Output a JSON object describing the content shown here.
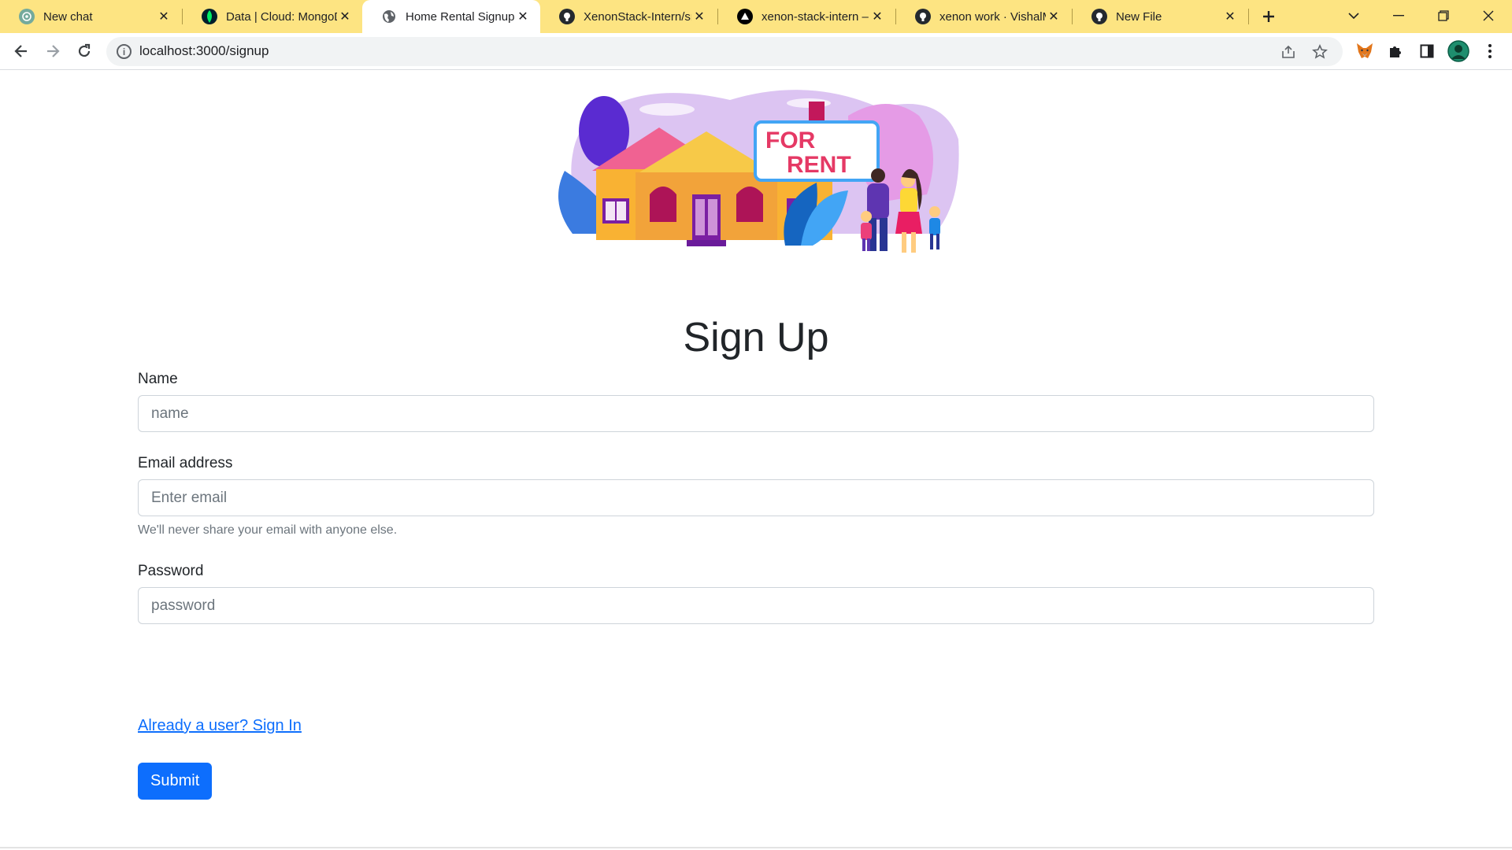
{
  "browser": {
    "tabs": [
      {
        "title": "New chat",
        "icon": "chatgpt-icon"
      },
      {
        "title": "Data | Cloud: MongoDB",
        "icon": "mongodb-leaf-icon"
      },
      {
        "title": "Home Rental Signup",
        "icon": "globe-icon"
      },
      {
        "title": "XenonStack-Intern/src",
        "icon": "github-icon"
      },
      {
        "title": "xenon-stack-intern – ",
        "icon": "vercel-icon"
      },
      {
        "title": "xenon work · VishalM",
        "icon": "github-icon"
      },
      {
        "title": "New File",
        "icon": "github-icon"
      }
    ],
    "active_tab_index": 2,
    "url": "localhost:3000/signup",
    "tab_bar_color": "#fde482"
  },
  "hero": {
    "sign_line1": "FOR",
    "sign_line2": "RENT"
  },
  "form": {
    "title": "Sign Up",
    "name_label": "Name",
    "name_placeholder": "name",
    "email_label": "Email address",
    "email_placeholder": "Enter email",
    "email_help": "We'll never share your email with anyone else.",
    "password_label": "Password",
    "password_placeholder": "password",
    "signin_link": "Already a user? Sign In",
    "submit_label": "Submit"
  },
  "colors": {
    "primary": "#0d6efd",
    "muted": "#6c757d"
  }
}
